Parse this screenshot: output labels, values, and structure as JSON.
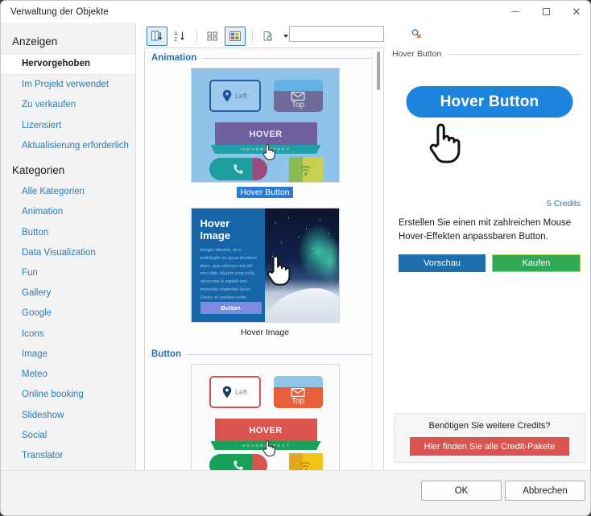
{
  "window": {
    "title": "Verwaltung der Objekte",
    "controls": {
      "minimize": "minimize-icon",
      "maximize": "maximize-icon",
      "close": "close-icon"
    }
  },
  "sidebar": {
    "groups": [
      {
        "heading": "Anzeigen",
        "items": [
          {
            "label": "Hervorgehoben",
            "active": true
          },
          {
            "label": "Im Projekt verwendet",
            "active": false
          },
          {
            "label": "Zu verkaufen",
            "active": false
          },
          {
            "label": "Lizensiert",
            "active": false
          },
          {
            "label": "Aktualisierung erforderlich",
            "active": false
          }
        ]
      },
      {
        "heading": "Kategorien",
        "items": [
          {
            "label": "Alle Kategorien",
            "active": false
          },
          {
            "label": "Animation",
            "active": false
          },
          {
            "label": "Button",
            "active": false
          },
          {
            "label": "Data Visualization",
            "active": false
          },
          {
            "label": "Fun",
            "active": false
          },
          {
            "label": "Gallery",
            "active": false
          },
          {
            "label": "Google",
            "active": false
          },
          {
            "label": "Icons",
            "active": false
          },
          {
            "label": "Image",
            "active": false
          },
          {
            "label": "Meteo",
            "active": false
          },
          {
            "label": "Online booking",
            "active": false
          },
          {
            "label": "Slideshow",
            "active": false
          },
          {
            "label": "Social",
            "active": false
          },
          {
            "label": "Translator",
            "active": false
          },
          {
            "label": "Utility",
            "active": false
          }
        ]
      }
    ]
  },
  "toolbar": {
    "buttons": [
      {
        "name": "sort-by-order-icon",
        "selected": false
      },
      {
        "name": "sort-alphabetical-icon",
        "selected": false
      },
      {
        "name": "list-view-icon",
        "selected": false
      },
      {
        "name": "grid-view-icon",
        "selected": true
      },
      {
        "name": "refresh-objects-icon",
        "selected": false
      }
    ],
    "dropdown_caret": "chevron-down-icon"
  },
  "search": {
    "value": "",
    "placeholder": "",
    "icon": "search-clear-icon"
  },
  "list": {
    "groups": [
      {
        "label": "Animation",
        "items": [
          {
            "caption": "Hover Button",
            "selected": true,
            "art": "button-demo-blue"
          },
          {
            "caption": "Hover Image",
            "selected": false,
            "art": "hover-image"
          }
        ]
      },
      {
        "label": "Button",
        "items": [
          {
            "caption": "",
            "selected": false,
            "art": "button-demo-red"
          }
        ]
      }
    ],
    "art_text": {
      "left_label": "Left",
      "top_label": "Top",
      "hover_label": "HOVER",
      "strip_label": "H O V E R  E F F E C T",
      "hover_image_title": "Hover Image",
      "hover_image_body": "Integer lobortis, mi a sollicitudin ex lacus tincidunt diam, quis ultricies nisl elit non nibh. Mauris urna nulla, venenatis in sapien non, imperdiet imperdiet lacus. Donec et sodales enim.",
      "hover_image_button": "Button"
    },
    "scrollbar": {
      "name": "vertical-scrollbar",
      "thumb_position_pct": 1
    }
  },
  "detail": {
    "header_title": "Hover Button",
    "preview_button_label": "Hover Button",
    "cursor": "hand-pointer-icon",
    "credits": "5 Credits",
    "description": "Erstellen Sie einen mit zahlreichen Mouse Hover-Effekten anpassbaren Button.",
    "preview_action": "Vorschau",
    "buy_action": "Kaufen",
    "credit_box": {
      "question": "Benötigen Sie weitere Credits?",
      "button": "Hier finden Sie alle Credit-Pakete"
    }
  },
  "footer": {
    "ok": "OK",
    "cancel": "Abbrechen"
  },
  "colors": {
    "accent_blue": "#1c84dd",
    "link_blue": "#2c7bb2",
    "buy_green": "#2eaa54",
    "preview_blue": "#1d6fab",
    "credit_red": "#d9534f",
    "selection_blue": "#2a7bd4"
  }
}
